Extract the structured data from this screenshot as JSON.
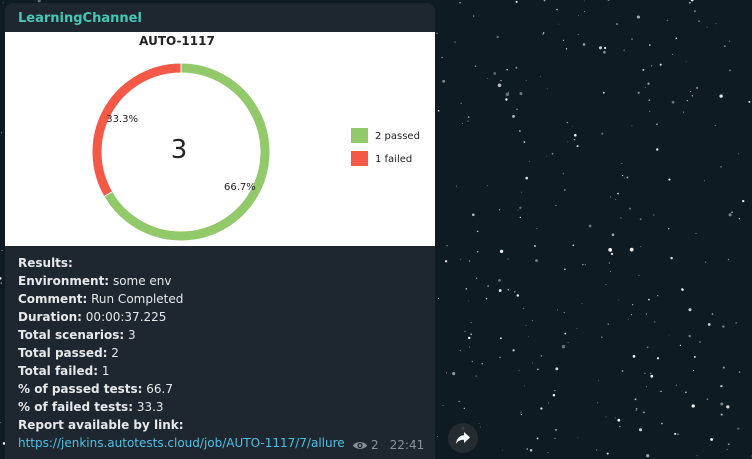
{
  "channel": {
    "name": "LearningChannel"
  },
  "chart_data": {
    "type": "pie",
    "title": "AUTO-1117",
    "center_label": "3",
    "series": [
      {
        "name": "2 passed",
        "value": 2,
        "percent_label": "66.7%",
        "color": "#92c96b"
      },
      {
        "name": "1 failed",
        "value": 1,
        "percent_label": "33.3%",
        "color": "#f45846"
      }
    ],
    "legend_position": "right"
  },
  "report": {
    "header": "Results:",
    "rows": [
      {
        "label": "Environment:",
        "value": "some env"
      },
      {
        "label": "Comment:",
        "value": "Run Completed"
      },
      {
        "label": "Duration:",
        "value": "00:00:37.225"
      },
      {
        "label": "Total scenarios:",
        "value": "3"
      },
      {
        "label": "Total passed:",
        "value": "2"
      },
      {
        "label": "Total failed:",
        "value": "1"
      },
      {
        "label": "% of passed tests:",
        "value": "66.7"
      },
      {
        "label": "% of failed tests:",
        "value": "33.3"
      }
    ],
    "link_label": "Report available by link:",
    "link_text": "https://jenkins.autotests.cloud/job/AUTO-1117/7/allure"
  },
  "meta": {
    "views": "2",
    "time": "22:41",
    "views_icon": "eye-icon"
  },
  "actions": {
    "share_icon": "share-icon"
  },
  "colors": {
    "channel": "#43c9b5",
    "link": "#4ec0e3",
    "bubble": "#1e272f"
  }
}
